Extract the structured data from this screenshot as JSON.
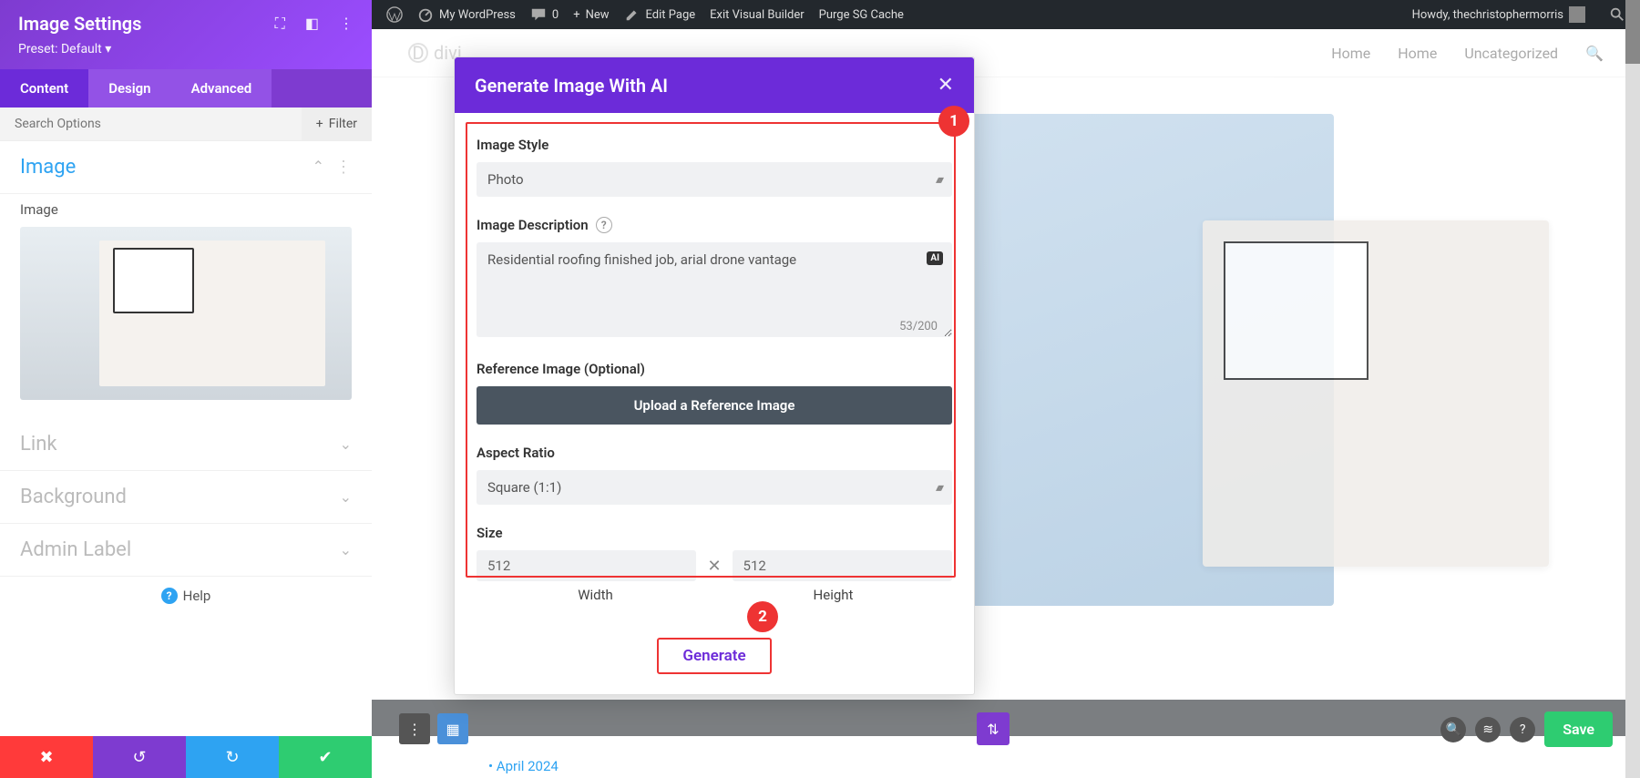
{
  "wp_bar": {
    "site": "My WordPress",
    "comments": "0",
    "new": "New",
    "edit": "Edit Page",
    "exit": "Exit Visual Builder",
    "purge": "Purge SG Cache",
    "howdy": "Howdy, thechristophermorris"
  },
  "settings": {
    "title": "Image Settings",
    "preset": "Preset: Default",
    "tabs": {
      "content": "Content",
      "design": "Design",
      "advanced": "Advanced"
    },
    "search_placeholder": "Search Options",
    "filter": "Filter",
    "sections": {
      "image": "Image",
      "link": "Link",
      "background": "Background",
      "admin_label": "Admin Label"
    },
    "image_label": "Image",
    "help": "Help"
  },
  "modal": {
    "title": "Generate Image With AI",
    "style_label": "Image Style",
    "style_value": "Photo",
    "desc_label": "Image Description",
    "desc_value": "Residential roofing finished job, arial drone vantage",
    "char_count": "53/200",
    "ai_badge": "AI",
    "ref_label": "Reference Image (Optional)",
    "upload": "Upload a Reference Image",
    "aspect_label": "Aspect Ratio",
    "aspect_value": "Square (1:1)",
    "size_label": "Size",
    "width": "512",
    "height": "512",
    "width_label": "Width",
    "height_label": "Height",
    "generate": "Generate"
  },
  "callouts": {
    "one": "1",
    "two": "2"
  },
  "site": {
    "logo": "divi",
    "nav": {
      "home1": "Home",
      "home2": "Home",
      "uncat": "Uncategorized"
    }
  },
  "builder": {
    "save": "Save"
  },
  "archive": "April 2024"
}
